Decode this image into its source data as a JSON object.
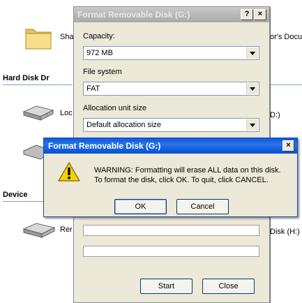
{
  "explorer": {
    "items": [
      {
        "label": "Sha"
      },
      {
        "label": "Loc"
      },
      {
        "label": "Rer"
      }
    ],
    "right_labels": {
      "top": "or's Docu",
      "middle": "D:)",
      "bottom": "Disk (H:)"
    },
    "sections": {
      "hard_disk": "Hard Disk Dr",
      "devices": "Device"
    }
  },
  "format_dialog": {
    "title": "Format Removable Disk (G:)",
    "help_button": "?",
    "close_button": "×",
    "capacity_label": "Capacity:",
    "capacity_value": "972 MB",
    "filesystem_label": "File system",
    "filesystem_value": "FAT",
    "alloc_label": "Allocation unit size",
    "alloc_value": "Default allocation size",
    "start_button": "Start",
    "close_label": "Close"
  },
  "warning_dialog": {
    "title": "Format Removable Disk (G:)",
    "close_button": "×",
    "message_line1": "WARNING: Formatting will erase ALL data on this disk.",
    "message_line2": "To format the disk, click OK. To quit, click CANCEL.",
    "ok_button": "OK",
    "cancel_button": "Cancel",
    "icon": "warning-icon"
  }
}
